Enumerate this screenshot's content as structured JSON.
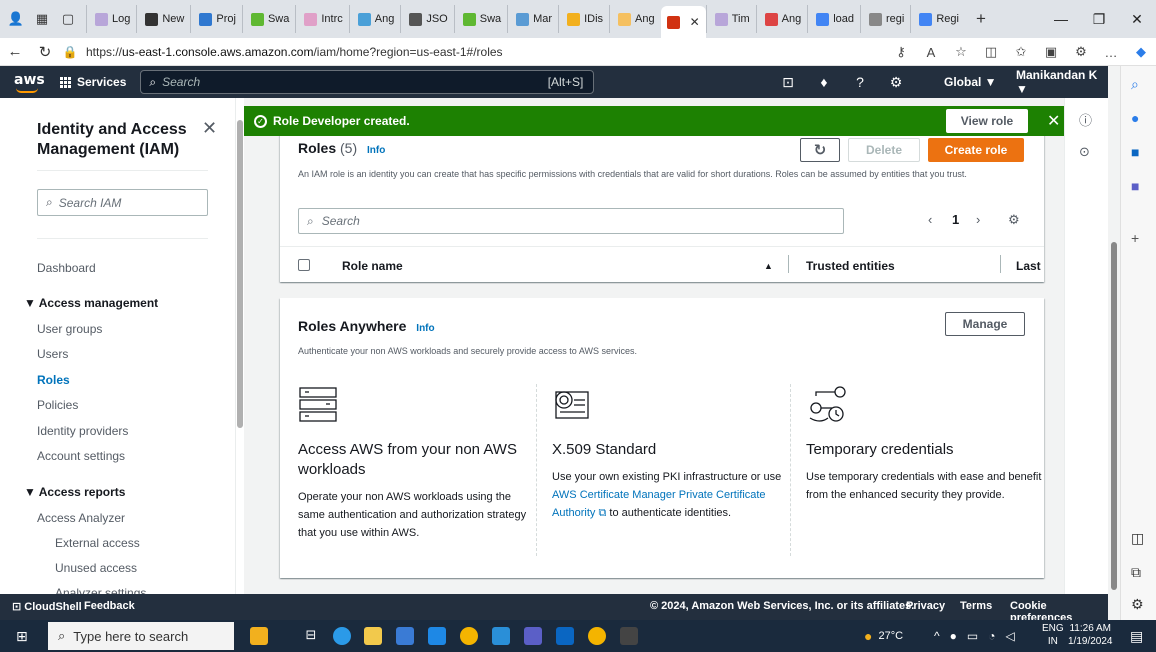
{
  "browser": {
    "tabs": [
      {
        "label": "Log",
        "color": "#b8a6d9"
      },
      {
        "label": "New",
        "color": "#333333"
      },
      {
        "label": "Proj",
        "color": "#2f78d0"
      },
      {
        "label": "Swa",
        "color": "#5fb832"
      },
      {
        "label": "Intrc",
        "color": "#e0a0c8"
      },
      {
        "label": "Ang",
        "color": "#4aa0d8"
      },
      {
        "label": "JSO",
        "color": "#555555"
      },
      {
        "label": "Swa",
        "color": "#5fb832"
      },
      {
        "label": "Mar",
        "color": "#5a9bd4"
      },
      {
        "label": "IDis",
        "color": "#f2b01e"
      },
      {
        "label": "Ang",
        "color": "#f5c060"
      }
    ],
    "active_tab": {
      "label": "",
      "color": "#d13212"
    },
    "tabs_after": [
      {
        "label": "Tim",
        "color": "#b8a6d9"
      },
      {
        "label": "Ang",
        "color": "#dd4444"
      },
      {
        "label": "load",
        "color": "#4285f4"
      },
      {
        "label": "regi",
        "color": "#888888"
      },
      {
        "label": "Regi",
        "color": "#4285f4"
      }
    ],
    "url_prefix": "https://",
    "url_host": "us-east-1.console.aws.amazon.com",
    "url_path": "/iam/home?region=us-east-1#/roles"
  },
  "awsnav": {
    "logo": "aws",
    "services": "Services",
    "search_placeholder": "Search",
    "search_shortcut": "[Alt+S]",
    "region": "Global ▼",
    "user": "Manikandan K ▼"
  },
  "sidebar": {
    "title": "Identity and Access Management (IAM)",
    "search_placeholder": "Search IAM",
    "dashboard": "Dashboard",
    "access_management": "Access management",
    "items": [
      "User groups",
      "Users",
      "Roles",
      "Policies",
      "Identity providers",
      "Account settings"
    ],
    "access_reports": "Access reports",
    "report_items": [
      "Access Analyzer"
    ],
    "report_sub": [
      "External access",
      "Unused access",
      "Analyzer settings"
    ]
  },
  "flash": {
    "message": "Role Developer created.",
    "view_button": "View role"
  },
  "roles": {
    "title": "Roles",
    "count": "(5)",
    "info": "Info",
    "description": "An IAM role is an identity you can create that has specific permissions with credentials that are valid for short durations. Roles can be assumed by entities that you trust.",
    "delete": "Delete",
    "create": "Create role",
    "search_placeholder": "Search",
    "page": "1",
    "col_name": "Role name",
    "col_trusted": "Trusted entities",
    "col_last": "Last"
  },
  "anywhere": {
    "title": "Roles Anywhere",
    "info": "Info",
    "description": "Authenticate your non AWS workloads and securely provide access to AWS services.",
    "manage": "Manage",
    "features": [
      {
        "title": "Access AWS from your non AWS workloads",
        "body": "Operate your non AWS workloads using the same authentication and authorization strategy that you use within AWS."
      },
      {
        "title": "X.509 Standard",
        "body_pre": "Use your own existing PKI infrastructure or use ",
        "link": "AWS Certificate Manager Private Certificate Authority",
        "body_post": " to authenticate identities."
      },
      {
        "title": "Temporary credentials",
        "body": "Use temporary credentials with ease and benefit from the enhanced security they provide."
      }
    ]
  },
  "footer": {
    "cloudshell": "CloudShell",
    "feedback": "Feedback",
    "copyright": "© 2024, Amazon Web Services, Inc. or its affiliates.",
    "privacy": "Privacy",
    "terms": "Terms",
    "cookies": "Cookie preferences"
  },
  "taskbar": {
    "search_placeholder": "Type here to search",
    "weather": "27°C",
    "lang": "ENG",
    "region": "IN",
    "time": "11:26 AM",
    "date": "1/19/2024"
  },
  "colors": {
    "aws_dark": "#232f3e",
    "success": "#1d8102",
    "primary": "#ec7211",
    "link": "#0073bb"
  }
}
